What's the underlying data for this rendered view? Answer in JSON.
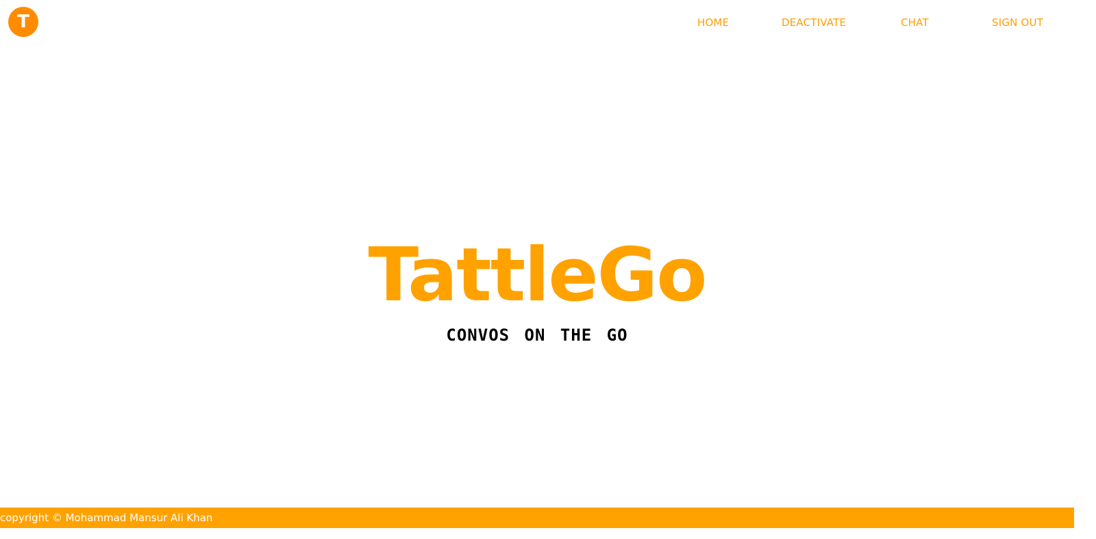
{
  "brand": {
    "logo_letter": "T",
    "color": "#ff8c00"
  },
  "nav": {
    "home": "HOME",
    "deactivate": "DEACTIVATE",
    "chat": "CHAT",
    "sign_out": "SIGN OUT"
  },
  "hero": {
    "title": "TattleGo",
    "subtitle": "CONVOS ON THE GO"
  },
  "footer": {
    "text": "copyright © Mohammad Mansur Ali Khan"
  },
  "colors": {
    "accent": "#ffa200",
    "nav_text": "#ff9e00",
    "background": "#ffffff"
  }
}
